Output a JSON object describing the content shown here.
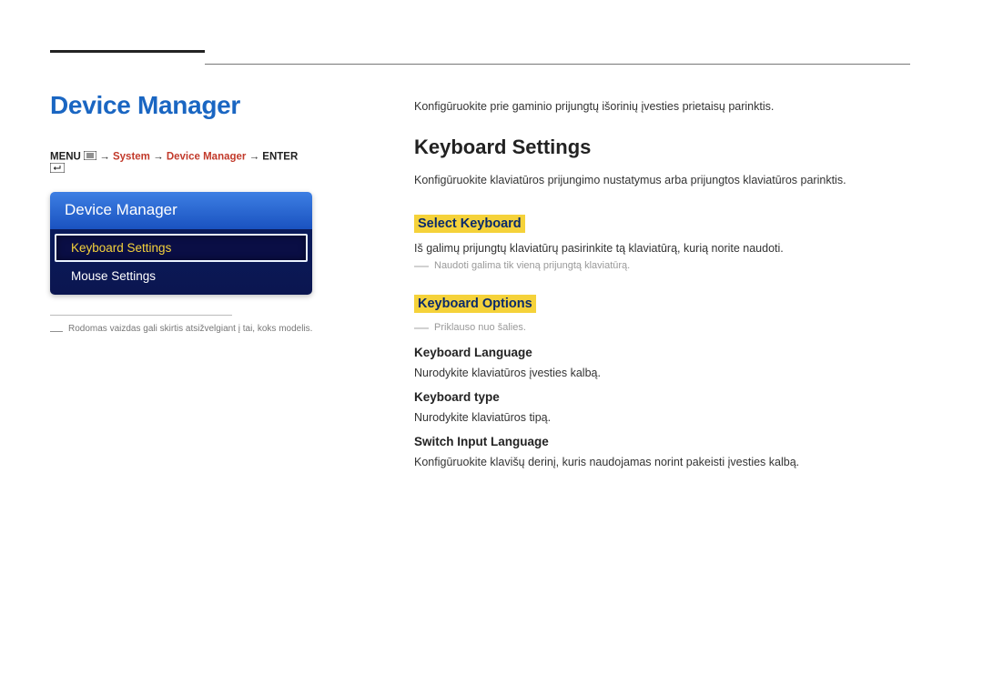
{
  "leftCol": {
    "title": "Device Manager",
    "breadcrumb": {
      "menu": "MENU",
      "system": "System",
      "deviceManager": "Device Manager",
      "enter": "ENTER",
      "arrow": "→"
    },
    "panel": {
      "header": "Device Manager",
      "items": [
        {
          "label": "Keyboard Settings",
          "selected": true
        },
        {
          "label": "Mouse Settings",
          "selected": false
        }
      ]
    },
    "note": "Rodomas vaizdas gali skirtis atsižvelgiant į tai, koks modelis."
  },
  "rightCol": {
    "intro": "Konfigūruokite prie gaminio prijungtų išorinių įvesties prietaisų parinktis.",
    "h2": "Keyboard Settings",
    "h2desc": "Konfigūruokite klaviatūros prijungimo nustatymus arba prijungtos klaviatūros parinktis.",
    "selectKeyboard": {
      "title": "Select Keyboard",
      "desc": "Iš galimų prijungtų klaviatūrų pasirinkite tą klaviatūrą, kurią norite naudoti.",
      "note": "Naudoti galima tik vieną prijungtą klaviatūrą."
    },
    "keyboardOptions": {
      "title": "Keyboard Options",
      "note": "Priklauso nuo šalies.",
      "lang": {
        "title": "Keyboard Language",
        "desc": "Nurodykite klaviatūros įvesties kalbą."
      },
      "type": {
        "title": "Keyboard type",
        "desc": "Nurodykite klaviatūros tipą."
      },
      "switch": {
        "title": "Switch Input Language",
        "desc": "Konfigūruokite klavišų derinį, kuris naudojamas norint pakeisti įvesties kalbą."
      }
    }
  }
}
